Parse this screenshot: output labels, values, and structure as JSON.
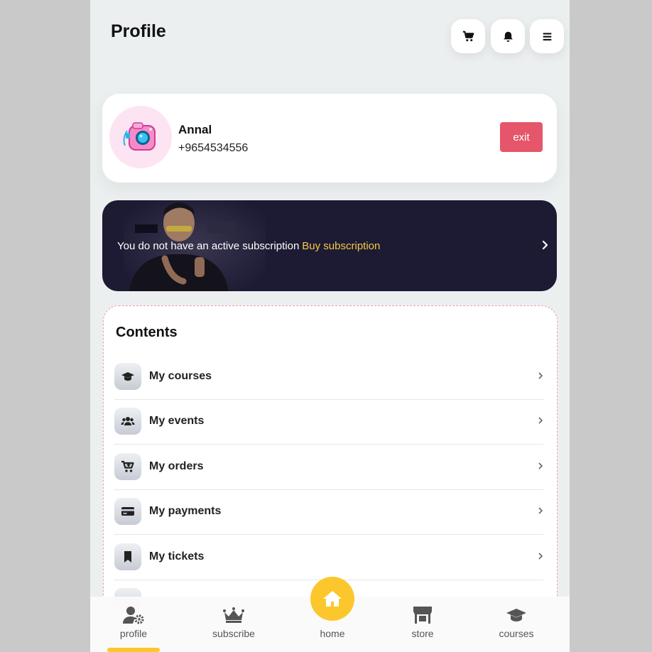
{
  "header": {
    "title": "Profile",
    "buttons": [
      {
        "icon": "cart-icon"
      },
      {
        "icon": "bell-icon"
      },
      {
        "icon": "menu-icon"
      }
    ]
  },
  "profile": {
    "avatar_icon": "camera-icon",
    "name": "Annal",
    "phone": "+9654534556",
    "exit_label": "exit"
  },
  "subscription": {
    "message": "You do not have an active subscription",
    "link": "Buy subscription"
  },
  "contents": {
    "title": "Contents",
    "items": [
      {
        "label": "My courses",
        "icon": "graduation-cap-icon"
      },
      {
        "label": "My events",
        "icon": "users-icon"
      },
      {
        "label": "My orders",
        "icon": "cart-plus-icon"
      },
      {
        "label": "My payments",
        "icon": "credit-card-icon"
      },
      {
        "label": "My tickets",
        "icon": "bookmark-icon"
      }
    ]
  },
  "nav": {
    "items": [
      {
        "label": "profile",
        "icon": "user-gear-icon"
      },
      {
        "label": "subscribe",
        "icon": "crown-icon"
      },
      {
        "label": "home",
        "icon": "house-icon"
      },
      {
        "label": "store",
        "icon": "store-icon"
      },
      {
        "label": "courses",
        "icon": "graduation-cap-icon"
      }
    ],
    "active": "profile"
  },
  "colors": {
    "accent": "#fcc72c",
    "exit": "#e5566a",
    "banner": "#1d1b33",
    "link": "#f6c944"
  }
}
